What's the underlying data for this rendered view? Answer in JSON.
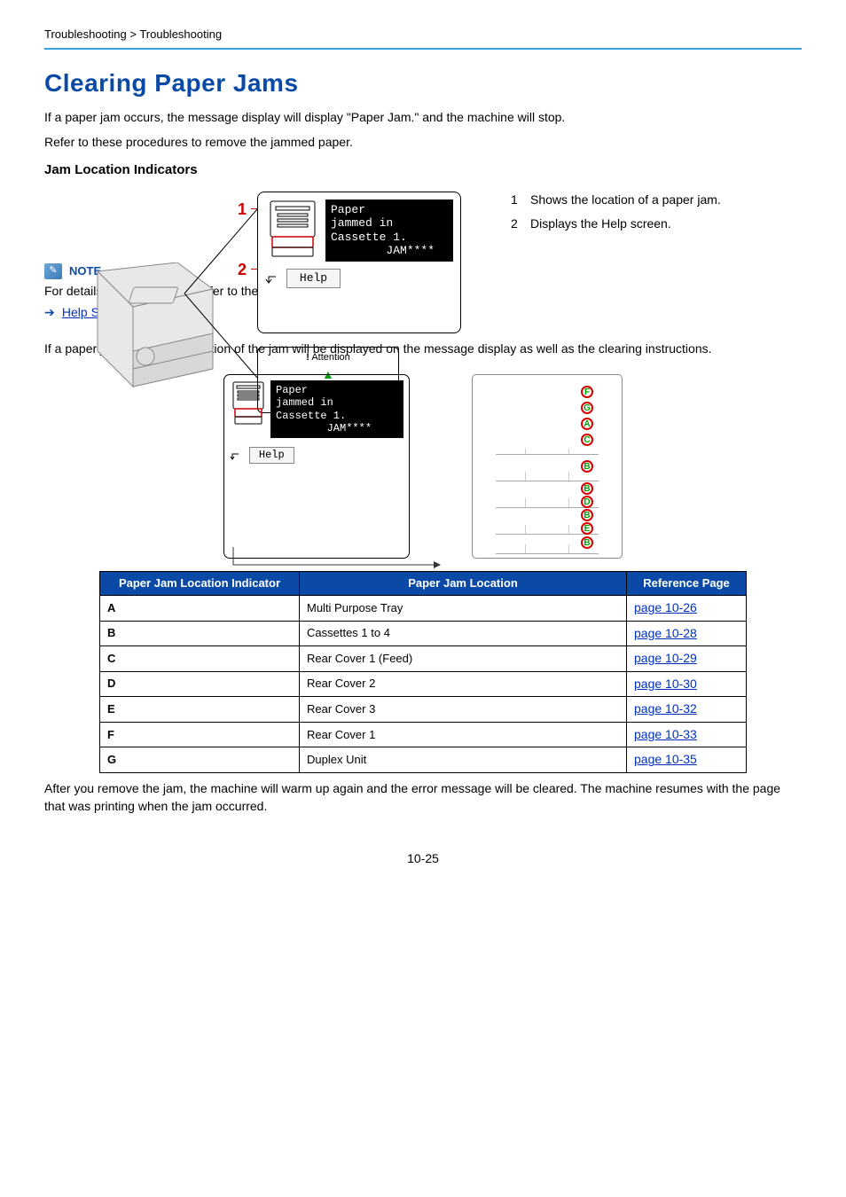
{
  "breadcrumb": "Troubleshooting > Troubleshooting",
  "title": "Clearing Paper Jams",
  "intro1": "If a paper jam occurs, the message display will display \"Paper Jam.\" and the machine will stop.",
  "intro2": "Refer to these procedures to remove the jammed paper.",
  "subhead": "Jam Location Indicators",
  "callouts": {
    "one": "1",
    "two": "2"
  },
  "screen": {
    "line1": "Paper",
    "line2": "jammed in",
    "line3": "Cassette 1.",
    "line4": "        JAM****",
    "help": "Help"
  },
  "attention_label": "Attention",
  "legend": [
    {
      "n": "1",
      "text": "Shows the location of a paper jam."
    },
    {
      "n": "2",
      "text": "Displays the Help screen."
    }
  ],
  "note": {
    "label": "NOTE",
    "body": "For details on Help Screen, refer to the following:",
    "link": "Help Screen (page 2-11)"
  },
  "para_after_note": "If a paper jam occurs, the location of the jam will be displayed on the message display as well as the clearing instructions.",
  "indicators": [
    "F",
    "G",
    "A",
    "C",
    "B",
    "B",
    "D",
    "B",
    "E",
    "B"
  ],
  "table": {
    "headers": {
      "indicator": "Paper Jam Location Indicator",
      "location": "Paper Jam Location",
      "ref": "Reference Page"
    },
    "rows": [
      {
        "ind": "A",
        "loc": "Multi Purpose Tray",
        "ref": "page 10-26"
      },
      {
        "ind": "B",
        "loc": "Cassettes 1 to 4",
        "ref": "page 10-28"
      },
      {
        "ind": "C",
        "loc": "Rear Cover 1 (Feed)",
        "ref": "page 10-29"
      },
      {
        "ind": "D",
        "loc": "Rear Cover 2",
        "ref": "page 10-30"
      },
      {
        "ind": "E",
        "loc": "Rear Cover 3",
        "ref": "page 10-32"
      },
      {
        "ind": "F",
        "loc": "Rear Cover 1",
        "ref": "page 10-33"
      },
      {
        "ind": "G",
        "loc": "Duplex Unit",
        "ref": "page 10-35"
      }
    ]
  },
  "closing": "After you remove the jam, the machine will warm up again and the error message will be cleared. The machine resumes with the page that was printing when the jam occurred.",
  "page_number": "10-25"
}
